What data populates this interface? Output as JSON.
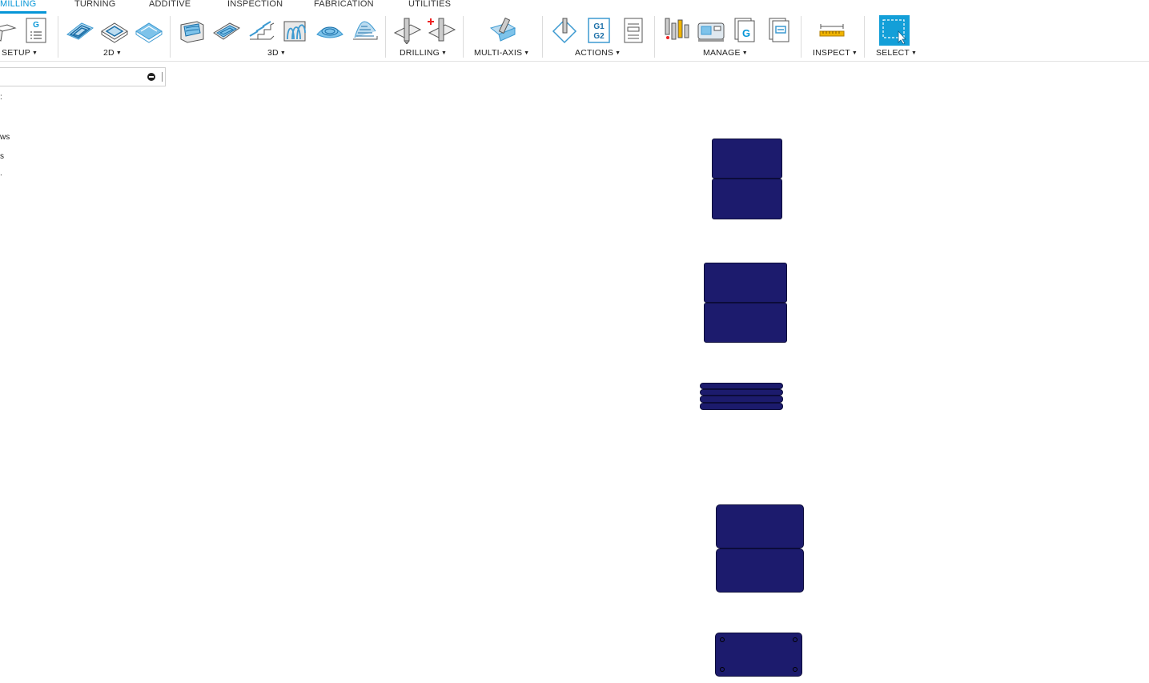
{
  "tabs": [
    {
      "label": "MILLING",
      "active": true
    },
    {
      "label": "TURNING"
    },
    {
      "label": "ADDITIVE"
    },
    {
      "label": "INSPECTION"
    },
    {
      "label": "FABRICATION"
    },
    {
      "label": "UTILITIES"
    }
  ],
  "toolbar": {
    "groups": {
      "setup": "SETUP",
      "two_d": "2D",
      "three_d": "3D",
      "drilling": "DRILLING",
      "multi_axis": "MULTI-AXIS",
      "actions": "ACTIONS",
      "manage": "MANAGE",
      "inspect": "INSPECT",
      "select": "SELECT"
    },
    "icons": {
      "setup": [
        "new-setup-icon",
        "nc-program-icon"
      ],
      "two_d": [
        "2d-adaptive-icon",
        "2d-pocket-icon",
        "face-icon"
      ],
      "three_d": [
        "adaptive-clearing-icon",
        "pocket-clearing-icon",
        "steep-and-shallow-icon",
        "flow-icon",
        "radial-icon",
        "spiral-icon"
      ],
      "drilling": [
        "drill-icon",
        "hole-recognition-icon"
      ],
      "multi_axis": [
        "swarf-icon"
      ],
      "actions": [
        "simulate-icon",
        "post-process-icon",
        "setup-sheet-icon"
      ],
      "manage": [
        "tool-library-icon",
        "machine-library-icon",
        "post-library-icon",
        "template-library-icon"
      ],
      "inspect": [
        "measure-icon"
      ],
      "select": [
        "window-select-icon"
      ]
    },
    "nc_program_letter": "G",
    "post_process_text": [
      "G1",
      "G2"
    ],
    "post_library_letter": "G"
  },
  "browser": {
    "search_value": "",
    "tree_items": [
      ":",
      "ws",
      "s",
      "."
    ]
  },
  "colors": {
    "accent": "#0696d7",
    "part_fill": "#1c1b6d",
    "icon_blue": "#3d9ad1"
  }
}
